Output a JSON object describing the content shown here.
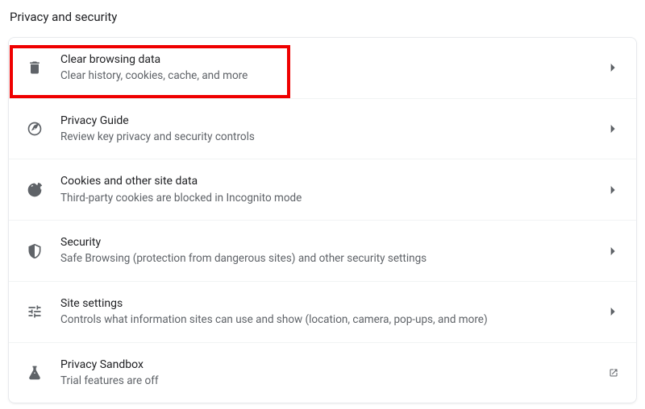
{
  "page": {
    "title": "Privacy and security"
  },
  "rows": [
    {
      "icon": "trash-icon",
      "title": "Clear browsing data",
      "subtitle": "Clear history, cookies, cache, and more",
      "action": "chevron"
    },
    {
      "icon": "compass-icon",
      "title": "Privacy Guide",
      "subtitle": "Review key privacy and security controls",
      "action": "chevron"
    },
    {
      "icon": "cookie-icon",
      "title": "Cookies and other site data",
      "subtitle": "Third-party cookies are blocked in Incognito mode",
      "action": "chevron"
    },
    {
      "icon": "shield-icon",
      "title": "Security",
      "subtitle": "Safe Browsing (protection from dangerous sites) and other security settings",
      "action": "chevron"
    },
    {
      "icon": "sliders-icon",
      "title": "Site settings",
      "subtitle": "Controls what information sites can use and show (location, camera, pop-ups, and more)",
      "action": "chevron"
    },
    {
      "icon": "flask-icon",
      "title": "Privacy Sandbox",
      "subtitle": "Trial features are off",
      "action": "external"
    }
  ]
}
